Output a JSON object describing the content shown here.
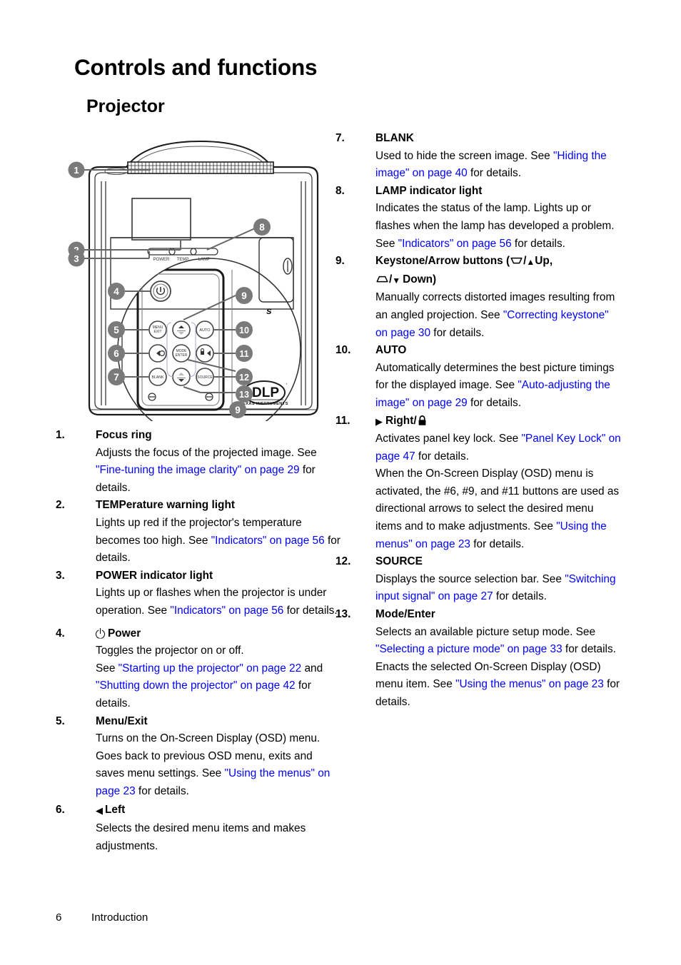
{
  "page": {
    "title": "Controls and functions",
    "subtitle": "Projector",
    "footer_page_number": "6",
    "footer_section": "Introduction",
    "link_color": "#0000ff",
    "callout_badge_color": "#7a7a7a"
  },
  "figure": {
    "name": "projector-top-view-diagram",
    "indicator_labels": [
      "POWER",
      "TEMP",
      "LAMP"
    ],
    "logo_main": "DLP",
    "logo_sub": "TEXAS INSTRUMENTS",
    "partial_label": "s",
    "callouts": [
      "1",
      "2",
      "3",
      "4",
      "5",
      "6",
      "7",
      "8",
      "9",
      "9",
      "10",
      "11",
      "12",
      "13"
    ],
    "buttons": [
      {
        "id": "power",
        "label": "⏻"
      },
      {
        "id": "menu-exit",
        "label": "MENU\nEXIT"
      },
      {
        "id": "left",
        "label": "◀"
      },
      {
        "id": "blank",
        "label": "BLANK"
      },
      {
        "id": "up-keystone",
        "label": "▲"
      },
      {
        "id": "mode-enter",
        "label": "MODE\nENTER"
      },
      {
        "id": "down-keystone",
        "label": "▼"
      },
      {
        "id": "auto",
        "label": "AUTO"
      },
      {
        "id": "right-lock",
        "label": "▶"
      },
      {
        "id": "source",
        "label": "SOURCE"
      }
    ]
  },
  "left_column": [
    {
      "number": "1.",
      "term": "Focus ring",
      "icon": "",
      "parts": [
        {
          "t": "Adjusts the focus of the projected image. See ",
          "link": false
        },
        {
          "t": "\"Fine-tuning the image clarity\" on page 29",
          "link": true
        },
        {
          "t": " for details.",
          "link": false
        }
      ]
    },
    {
      "number": "2.",
      "term": "TEMPerature warning light",
      "icon": "",
      "parts": [
        {
          "t": "Lights up red if the projector's temperature becomes too high. See ",
          "link": false
        },
        {
          "t": "\"Indicators\" on page 56",
          "link": true
        },
        {
          "t": " for details.",
          "link": false
        }
      ]
    },
    {
      "number": "3.",
      "term": "POWER indicator light",
      "icon": "",
      "parts": [
        {
          "t": "Lights up or flashes when the projector is under operation. See ",
          "link": false
        },
        {
          "t": "\"Indicators\" on page 56",
          "link": true
        },
        {
          "t": " for details.",
          "link": false
        }
      ]
    },
    {
      "number": "4.",
      "term": "Power",
      "icon": "power-icon",
      "parts": [
        {
          "t": "Toggles the projector on or off.",
          "link": false,
          "br": true
        },
        {
          "t": "See ",
          "link": false
        },
        {
          "t": "\"Starting up the projector\" on page 22",
          "link": true
        },
        {
          "t": " and ",
          "link": false
        },
        {
          "t": "\"Shutting down the projector\" on page 42",
          "link": true
        },
        {
          "t": " for details.",
          "link": false
        }
      ]
    },
    {
      "number": "5.",
      "term": "Menu/Exit",
      "icon": "",
      "parts": [
        {
          "t": "Turns on the On-Screen Display (OSD) menu. Goes back to previous OSD menu, exits and saves menu settings. See ",
          "link": false
        },
        {
          "t": "\"Using the menus\" on page 23",
          "link": true
        },
        {
          "t": " for details.",
          "link": false
        }
      ]
    },
    {
      "number": "6.",
      "term": "Left",
      "icon": "triangle-left-icon",
      "parts": [
        {
          "t": " Selects the desired menu items and makes adjustments.",
          "link": false
        }
      ]
    }
  ],
  "right_column": [
    {
      "number": "7.",
      "term": "BLANK",
      "icon": "",
      "parts": [
        {
          "t": "Used to hide the screen image. See ",
          "link": false
        },
        {
          "t": "\"Hiding the image\" on page 40",
          "link": true
        },
        {
          "t": " for details.",
          "link": false
        }
      ]
    },
    {
      "number": "8.",
      "term": "LAMP indicator light",
      "icon": "",
      "parts": [
        {
          "t": "Indicates the status of the lamp. Lights up or flashes when the lamp has developed a problem. See ",
          "link": false
        },
        {
          "t": "\"Indicators\" on page 56",
          "link": true
        },
        {
          "t": " for details.",
          "link": false
        }
      ]
    },
    {
      "number": "9.",
      "term": "Keystone/Arrow buttons (",
      "term_suffix_up": "Up,",
      "term_suffix_down": "Down)",
      "icon": "keystone-icons",
      "parts": [
        {
          "t": "Manually corrects distorted images resulting from an angled projection. See ",
          "link": false
        },
        {
          "t": "\"Correcting keystone\" on page 30",
          "link": true
        },
        {
          "t": " for details.",
          "link": false
        }
      ]
    },
    {
      "number": "10.",
      "term": "AUTO",
      "icon": "",
      "parts": [
        {
          "t": "Automatically determines the best picture timings for the displayed image. See ",
          "link": false
        },
        {
          "t": "\"Auto-adjusting the image\" on page 29",
          "link": true
        },
        {
          "t": " for details.",
          "link": false
        }
      ]
    },
    {
      "number": "11.",
      "term": "Right/",
      "icon": "triangle-right-icon-lock-icon",
      "parts": [
        {
          "t": "Activates panel key lock. See ",
          "link": false
        },
        {
          "t": "\"Panel Key Lock\" on page 47",
          "link": true
        },
        {
          "t": " for details.",
          "link": false,
          "br": true
        },
        {
          "t": "When the On-Screen Display (OSD) menu is activated, the #6, #9, and #11 buttons are used as directional arrows to select the desired menu items and to make adjustments. See ",
          "link": false
        },
        {
          "t": "\"Using the menus\" on page 23",
          "link": true
        },
        {
          "t": " for details.",
          "link": false
        }
      ]
    },
    {
      "number": "12.",
      "term": "SOURCE",
      "icon": "",
      "parts": [
        {
          "t": "Displays the source selection bar. See ",
          "link": false
        },
        {
          "t": "\"Switching input signal\" on page 27",
          "link": true
        },
        {
          "t": " for details.",
          "link": false
        }
      ]
    },
    {
      "number": "13.",
      "term": "Mode/Enter",
      "icon": "",
      "parts": [
        {
          "t": "Selects an available picture setup mode. See ",
          "link": false
        },
        {
          "t": "\"Selecting a picture mode\" on page 33",
          "link": true
        },
        {
          "t": " for details.",
          "link": false,
          "br": true
        },
        {
          "t": "Enacts the selected On-Screen Display (OSD) menu item. See ",
          "link": false
        },
        {
          "t": "\"Using the menus\" on page 23",
          "link": true
        },
        {
          "t": " for details.",
          "link": false
        }
      ]
    }
  ]
}
